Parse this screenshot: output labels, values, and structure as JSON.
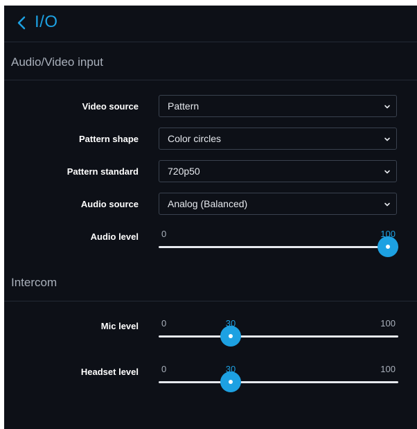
{
  "header": {
    "title": "I/O"
  },
  "sections": {
    "av_title": "Audio/Video input",
    "intercom_title": "Intercom"
  },
  "av": {
    "video_source": {
      "label": "Video source",
      "value": "Pattern"
    },
    "pattern_shape": {
      "label": "Pattern shape",
      "value": "Color circles"
    },
    "pattern_standard": {
      "label": "Pattern standard",
      "value": "720p50"
    },
    "audio_source": {
      "label": "Audio source",
      "value": "Analog (Balanced)"
    },
    "audio_level": {
      "label": "Audio level",
      "min": "0",
      "max": "100",
      "value": 100
    }
  },
  "intercom": {
    "mic_level": {
      "label": "Mic level",
      "min": "0",
      "max": "100",
      "value": 30,
      "value_label": "30"
    },
    "headset_level": {
      "label": "Headset level",
      "min": "0",
      "max": "100",
      "value": 30,
      "value_label": "30"
    }
  },
  "colors": {
    "accent": "#1da1e2",
    "panel_bg": "#0d1017",
    "text": "#e6e9ee",
    "muted": "#a9b0bb"
  }
}
